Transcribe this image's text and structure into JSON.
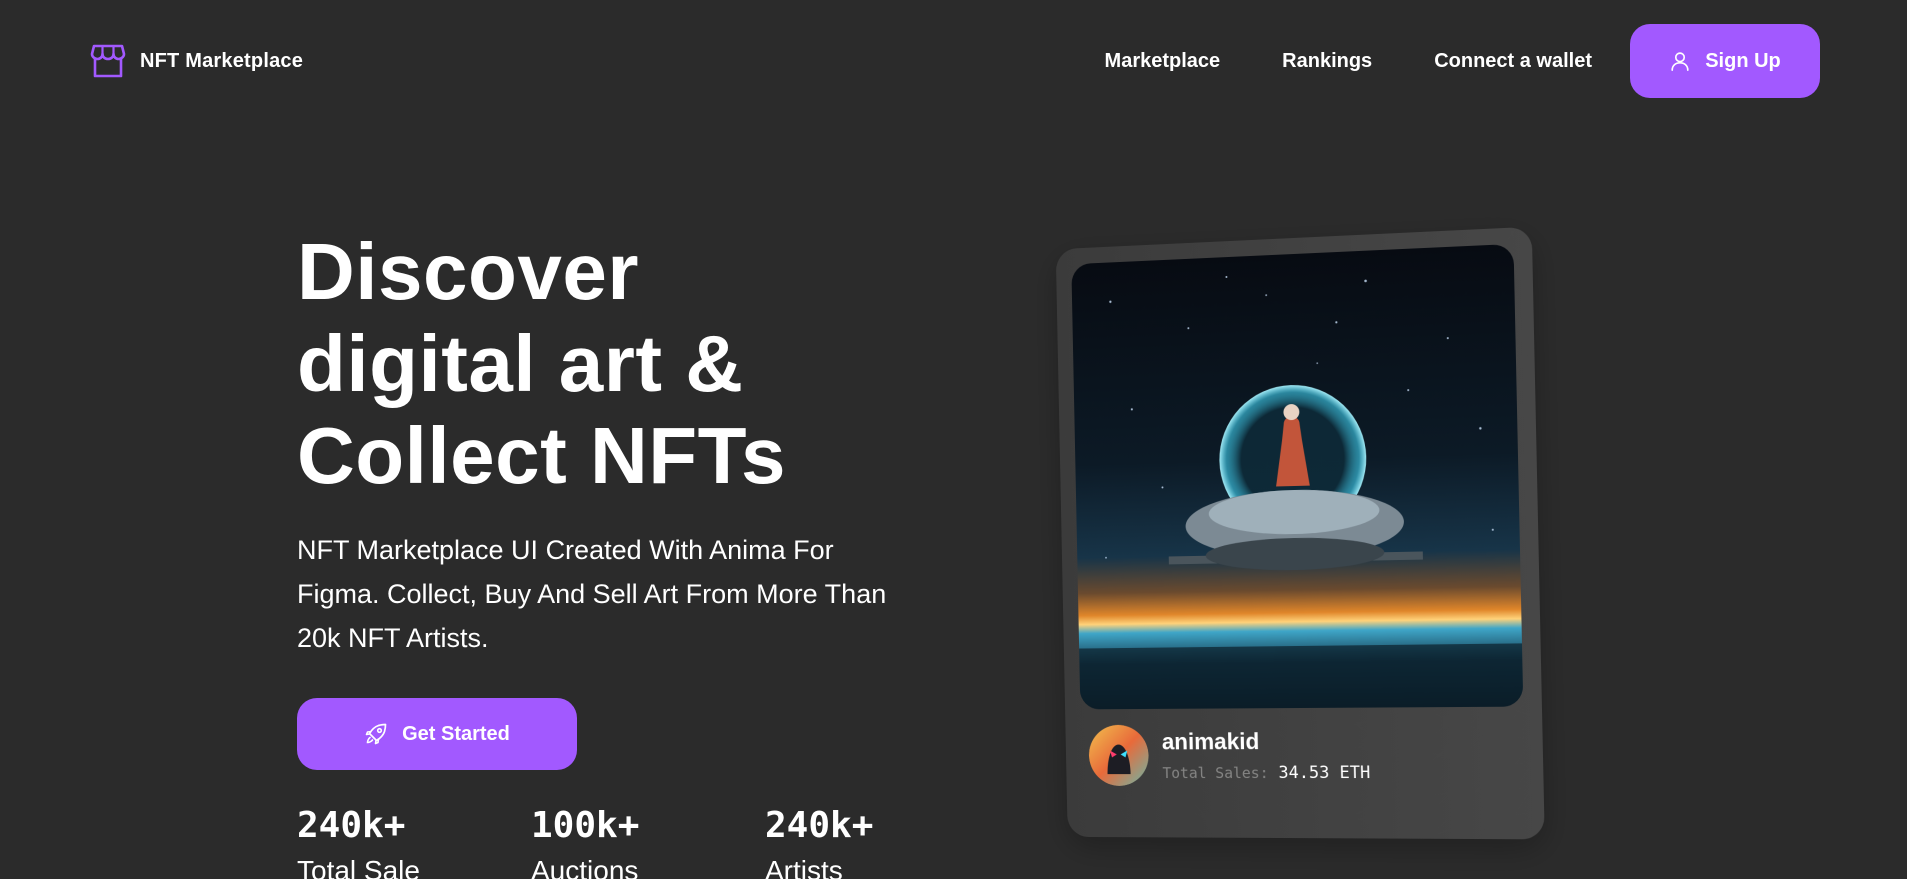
{
  "nav": {
    "brand_name": "NFT Marketplace",
    "brand_icon": "storefront-icon",
    "links": [
      "Marketplace",
      "Rankings",
      "Connect a wallet"
    ],
    "signup_label": "Sign Up",
    "signup_icon": "user-icon"
  },
  "hero": {
    "title_lines": [
      "Discover",
      "digital art &",
      "Collect NFTs"
    ],
    "subtitle": "NFT Marketplace UI Created With Anima For Figma. Collect, Buy And Sell Art From More Than 20k NFT Artists.",
    "cta_label": "Get Started",
    "cta_icon": "rocket-icon"
  },
  "stats": [
    {
      "value": "240k+",
      "label": "Total Sale"
    },
    {
      "value": "100k+",
      "label": "Auctions"
    },
    {
      "value": "240k+",
      "label": "Artists"
    }
  ],
  "card": {
    "artist_name": "animakid",
    "sales_label": "Total Sales:",
    "sales_value": "34.53 ETH"
  },
  "colors": {
    "background": "#2b2b2b",
    "accent": "#a259ff",
    "card": "#3b3b3b",
    "muted_text": "#858584"
  }
}
